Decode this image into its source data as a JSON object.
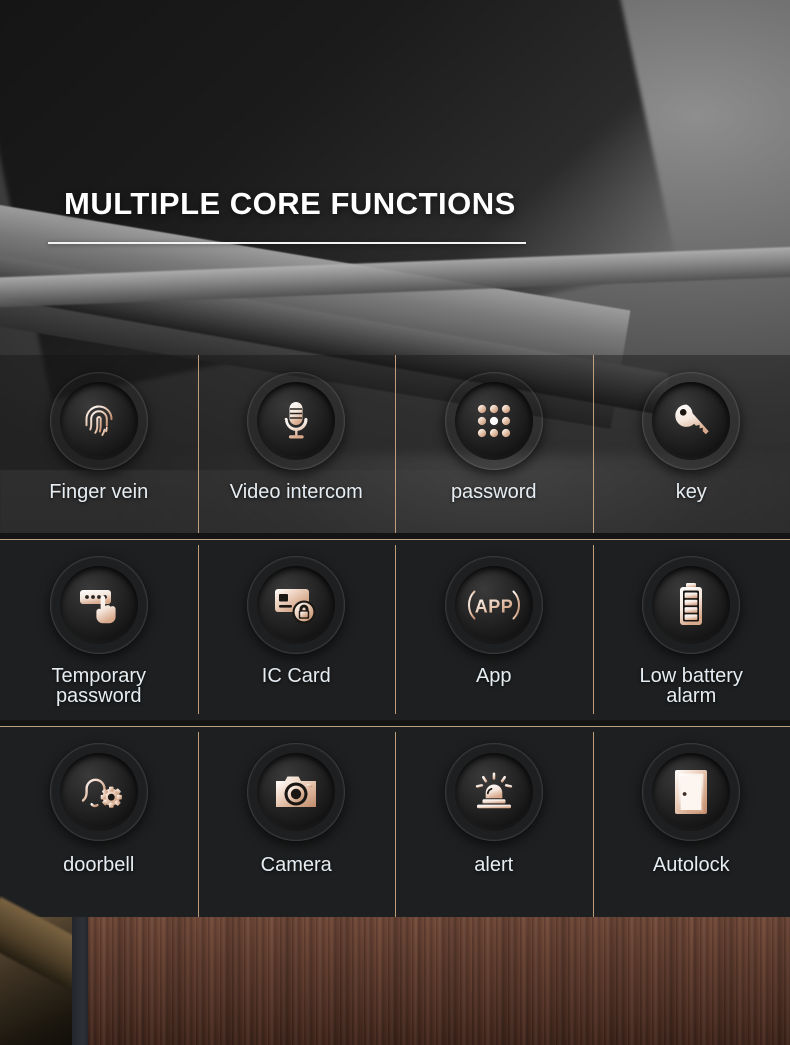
{
  "header": {
    "title": "MULTIPLE CORE FUNCTIONS"
  },
  "colors": {
    "gold_light": "#f6e3b9",
    "gold_mid": "#c9a96a",
    "gold_dark": "#6d5532",
    "divider": "#cfa983",
    "label_text": "#e6edf2",
    "panel_bg": "#1e1f20",
    "icon_copper": "#e0b79a",
    "door_wood": "#60392a"
  },
  "grid": {
    "rows": [
      {
        "cells": [
          {
            "label": "Finger vein",
            "icon": "fingerprint-icon"
          },
          {
            "label": "Video intercom",
            "icon": "microphone-icon"
          },
          {
            "label": "password",
            "icon": "keypad-dots-icon"
          },
          {
            "label": "key",
            "icon": "key-icon"
          }
        ]
      },
      {
        "cells": [
          {
            "label": "Temporary\npassword",
            "icon": "password-hand-icon"
          },
          {
            "label": "IC Card",
            "icon": "card-lock-icon"
          },
          {
            "label": "App",
            "icon": "app-bracket-icon"
          },
          {
            "label": "Low battery\nalarm",
            "icon": "battery-icon"
          }
        ]
      },
      {
        "cells": [
          {
            "label": "doorbell",
            "icon": "bell-gear-icon"
          },
          {
            "label": "Camera",
            "icon": "camera-icon"
          },
          {
            "label": "alert",
            "icon": "siren-icon"
          },
          {
            "label": "Autolock",
            "icon": "door-icon"
          }
        ]
      }
    ]
  }
}
